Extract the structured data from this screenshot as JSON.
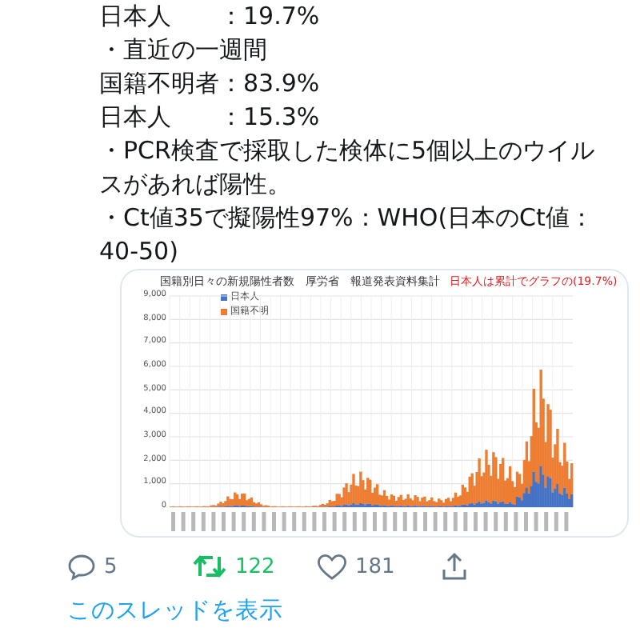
{
  "tweet_text": [
    "日本人　　：19.7%",
    "・直近の一週間",
    "国籍不明者：83.9%",
    "日本人　　：15.3%",
    "・PCR検査で採取した検体に5個以上のウイルスがあれば陽性。",
    "・Ct値35で擬陽性97%：WHO(日本のCt値：40-50)"
  ],
  "chart_image": {
    "title": "国籍別日々の新規陽性者数　厚労省　報道発表資料集計",
    "note": "日本人は累計でグラフの(19.7%)",
    "legend": [
      {
        "label": "日本人",
        "color": "#4472c4"
      },
      {
        "label": "国籍不明",
        "color": "#ed7d31"
      }
    ],
    "y_labels": [
      "9,000",
      "8,000",
      "7,000",
      "6,000",
      "5,000",
      "4,000",
      "3,000",
      "2,000",
      "1,000",
      "0"
    ]
  },
  "actions": {
    "replies": "5",
    "retweets": "122",
    "retweeted": true,
    "likes": "181"
  },
  "thread_link": "このスレッドを表示"
}
